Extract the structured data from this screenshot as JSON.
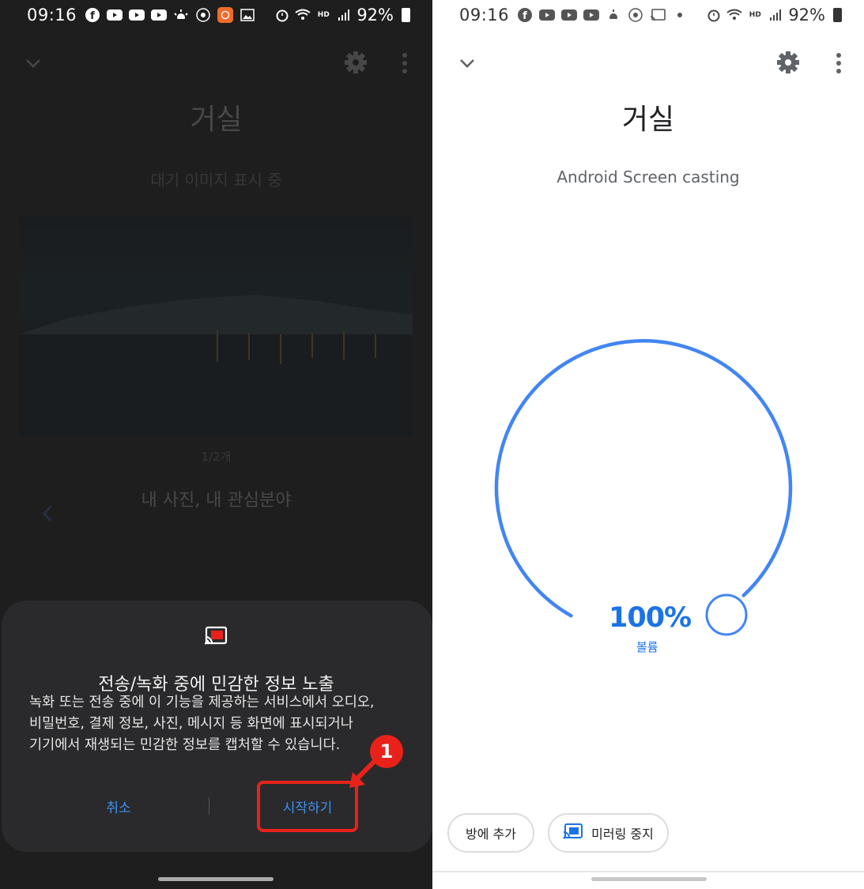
{
  "left": {
    "status": {
      "time": "09:16",
      "battery": "92%"
    },
    "room_title": "거실",
    "status_text": "대기 이미지 표시 중",
    "photo_counter": "1/2개",
    "album_label": "내 사진, 내 관심분야",
    "dialog": {
      "title": "전송/녹화 중에 민감한 정보 노출",
      "body_lines": [
        "녹화 또는 전송 중에 이 기능을 제공하는 서비스에서 오디오,",
        "비밀번호, 결제 정보, 사진, 메시지 등 화면에 표시되거나",
        "기기에서 재생되는 민감한 정보를 캡처할 수 있습니다."
      ],
      "cancel_label": "취소",
      "start_label": "시작하기"
    },
    "step_badge": "1"
  },
  "right": {
    "status": {
      "time": "09:16",
      "battery": "92%"
    },
    "room_title": "거실",
    "status_text": "Android Screen casting",
    "volume": {
      "value_label": "100%",
      "label": "볼륨",
      "level": 1.0
    },
    "chips": {
      "add_to_room": "방에 추가",
      "stop_mirroring": "미러링 중지"
    }
  },
  "colors": {
    "accent_blue": "#4285f4",
    "annotation_red": "#e8221a",
    "dialog_bg": "#2a2a2c"
  }
}
